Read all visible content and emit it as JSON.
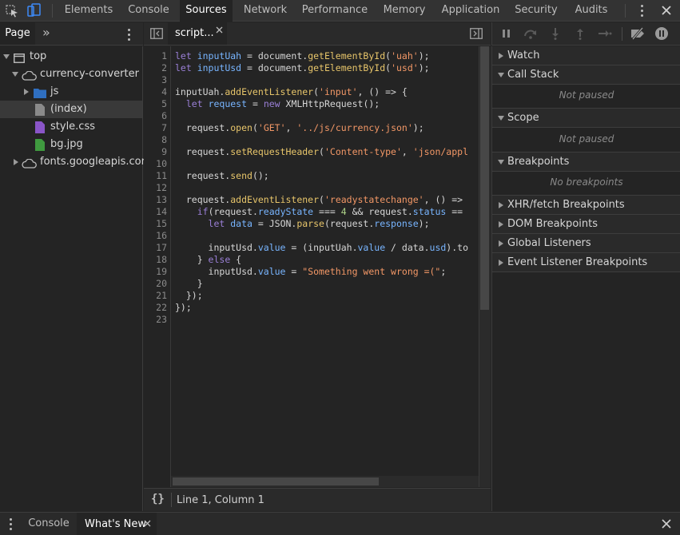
{
  "main_tabs": [
    {
      "label": "Elements"
    },
    {
      "label": "Console"
    },
    {
      "label": "Sources"
    },
    {
      "label": "Network"
    },
    {
      "label": "Performance"
    },
    {
      "label": "Memory"
    },
    {
      "label": "Application"
    },
    {
      "label": "Security"
    },
    {
      "label": "Audits"
    }
  ],
  "active_tab": "Sources",
  "navigator": {
    "tab_label": "Page",
    "more_glyph": "»",
    "tree": [
      {
        "label": "top",
        "icon": "frame-icon",
        "expanded": true
      },
      {
        "label": "currency-converter",
        "icon": "cloud-icon",
        "expanded": true
      },
      {
        "label": "js",
        "icon": "folder-icon",
        "expanded": false
      },
      {
        "label": "(index)",
        "icon": "document-icon",
        "selected": true
      },
      {
        "label": "style.css",
        "icon": "stylesheet-icon"
      },
      {
        "label": "bg.jpg",
        "icon": "image-icon"
      },
      {
        "label": "fonts.googleapis.com",
        "icon": "cloud-icon",
        "expanded": false
      }
    ]
  },
  "editor": {
    "open_file": "script...",
    "line_numbers": [
      "1",
      "2",
      "3",
      "4",
      "5",
      "6",
      "7",
      "8",
      "9",
      "10",
      "11",
      "12",
      "13",
      "14",
      "15",
      "16",
      "17",
      "18",
      "19",
      "20",
      "21",
      "22",
      "23"
    ],
    "status_text": "Line 1, Column 1",
    "format_glyph": "{}"
  },
  "debugger": {
    "sections": [
      {
        "label": "Watch",
        "expanded": false
      },
      {
        "label": "Call Stack",
        "expanded": true,
        "empty_text": "Not paused"
      },
      {
        "label": "Scope",
        "expanded": true,
        "empty_text": "Not paused"
      },
      {
        "label": "Breakpoints",
        "expanded": true,
        "empty_text": "No breakpoints"
      },
      {
        "label": "XHR/fetch Breakpoints",
        "expanded": false
      },
      {
        "label": "DOM Breakpoints",
        "expanded": false
      },
      {
        "label": "Global Listeners",
        "expanded": false
      },
      {
        "label": "Event Listener Breakpoints",
        "expanded": false
      }
    ]
  },
  "drawer": {
    "tabs": [
      {
        "label": "Console"
      },
      {
        "label": "What's New",
        "active": true
      }
    ]
  },
  "colors": {
    "keyword": "#9a7fd6",
    "variable": "#78b5ff",
    "string": "#f29766",
    "function": "#e7c56a",
    "number": "#b0d58a",
    "accent": "#3d8af7"
  }
}
